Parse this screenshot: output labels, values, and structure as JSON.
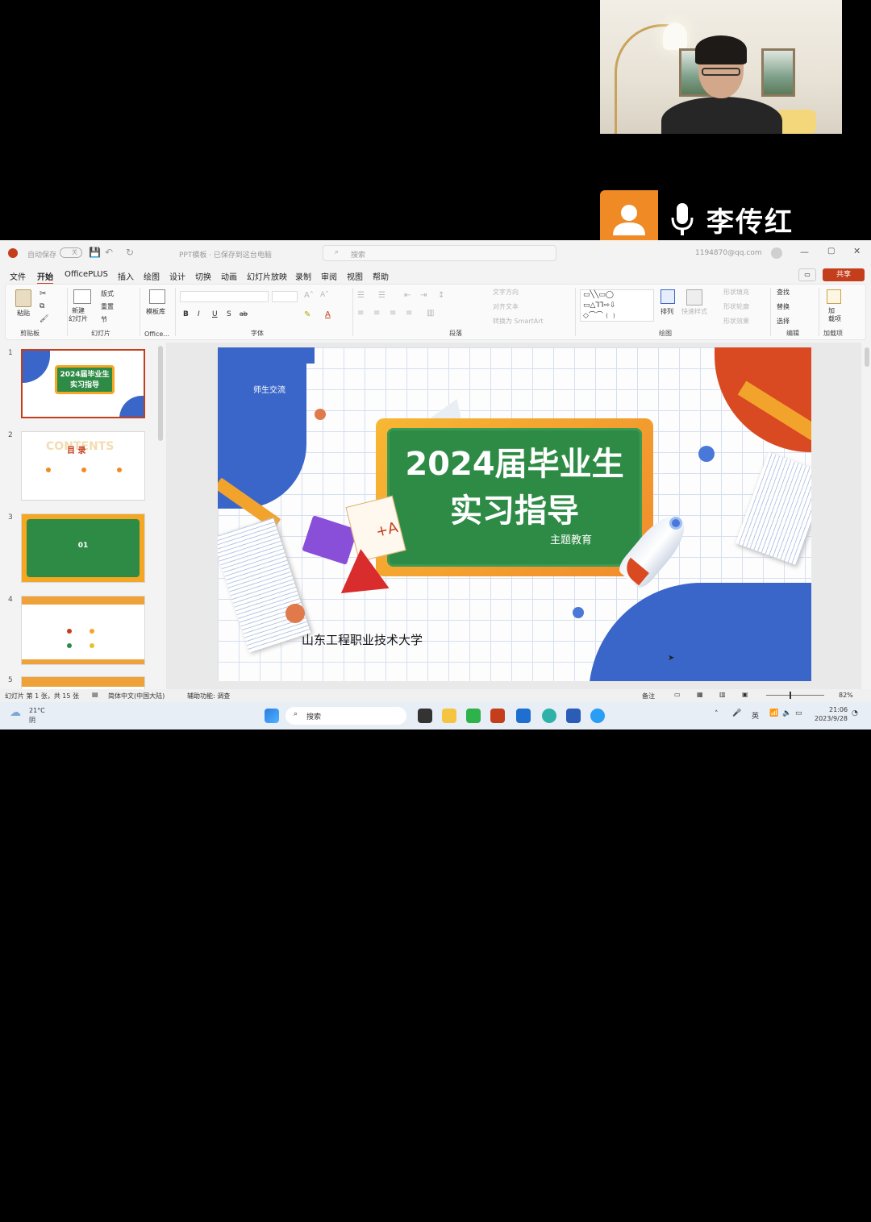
{
  "speaker": {
    "name": "李传红"
  },
  "titlebar": {
    "autosave_label": "自动保存",
    "toggle_label": "关",
    "doc_title": "PPT模板 · 已保存到这台电脑",
    "search_placeholder": "搜索",
    "account": "1194870@qq.com"
  },
  "tabs": [
    "文件",
    "开始",
    "OfficePLUS",
    "插入",
    "绘图",
    "设计",
    "切换",
    "动画",
    "幻灯片放映",
    "录制",
    "审阅",
    "视图",
    "帮助"
  ],
  "share_label": "共享",
  "ribbon": {
    "paste": "粘贴",
    "clipboard_group": "剪贴板",
    "new_slide": "新建\n幻灯片",
    "layout": "版式",
    "reset": "重置",
    "section": "节",
    "slides_group": "幻灯片",
    "template_lib": "模板库",
    "office_group": "Office...",
    "font_group": "字体",
    "text_direction": "文字方向",
    "align_text": "对齐文本",
    "smartart": "转换为 SmartArt",
    "paragraph_group": "段落",
    "arrange": "排列",
    "quick_styles": "快速样式",
    "shape_fill": "形状填充",
    "shape_outline": "形状轮廓",
    "shape_effects": "形状效果",
    "drawing_group": "绘图",
    "find": "查找",
    "replace": "替换",
    "select": "选择",
    "editing_group": "编辑",
    "addins": "加\n载项",
    "addins_group": "加载项"
  },
  "thumbnails": [
    {
      "num": "1",
      "line1": "2024届毕业生",
      "line2": "实习指导"
    },
    {
      "num": "2",
      "title": "目  录",
      "watermark": "CONTENTS"
    },
    {
      "num": "3",
      "title": "01"
    },
    {
      "num": "4",
      "title": ""
    },
    {
      "num": "5",
      "title": ""
    }
  ],
  "slide": {
    "corner_tag": "师生交流",
    "title_line1": "2024届毕业生",
    "title_line2": "实习指导",
    "subtitle": "主题教育",
    "university": "山东工程职业技术大学"
  },
  "statusbar": {
    "slide_info": "幻灯片 第 1 张，共 15 张",
    "language": "简体中文(中国大陆)",
    "accessibility": "辅助功能: 调查",
    "notes": "备注",
    "zoom": "82%"
  },
  "taskbar": {
    "weather_temp": "21°C",
    "weather_desc": "阴",
    "search_label": "搜索",
    "ime": "英",
    "time": "21:06",
    "date": "2023/9/28"
  },
  "colors": {
    "ppt_accent": "#c43e1c",
    "board_green": "#2e8b45",
    "board_orange": "#f5a623",
    "blob_blue": "#3a66c9",
    "speaker_orange": "#f08a24"
  }
}
